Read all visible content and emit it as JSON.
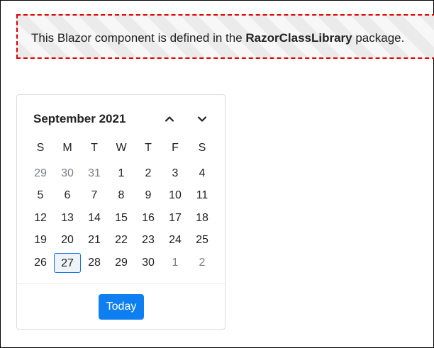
{
  "banner": {
    "prefix": "This Blazor component is defined in the ",
    "package_name": "RazorClassLibrary",
    "suffix": " package."
  },
  "calendar": {
    "month_label": "September 2021",
    "prev_icon": "chevron-up-icon",
    "next_icon": "chevron-down-icon",
    "weekdays": [
      "S",
      "M",
      "T",
      "W",
      "T",
      "F",
      "S"
    ],
    "weeks": [
      [
        {
          "d": "29",
          "other": true
        },
        {
          "d": "30",
          "other": true
        },
        {
          "d": "31",
          "other": true
        },
        {
          "d": "1"
        },
        {
          "d": "2"
        },
        {
          "d": "3"
        },
        {
          "d": "4"
        }
      ],
      [
        {
          "d": "5"
        },
        {
          "d": "6"
        },
        {
          "d": "7"
        },
        {
          "d": "8"
        },
        {
          "d": "9"
        },
        {
          "d": "10"
        },
        {
          "d": "11"
        }
      ],
      [
        {
          "d": "12"
        },
        {
          "d": "13"
        },
        {
          "d": "14"
        },
        {
          "d": "15"
        },
        {
          "d": "16"
        },
        {
          "d": "17"
        },
        {
          "d": "18"
        }
      ],
      [
        {
          "d": "19"
        },
        {
          "d": "20"
        },
        {
          "d": "21"
        },
        {
          "d": "22"
        },
        {
          "d": "23"
        },
        {
          "d": "24"
        },
        {
          "d": "25"
        }
      ],
      [
        {
          "d": "26"
        },
        {
          "d": "27",
          "selected": true
        },
        {
          "d": "28"
        },
        {
          "d": "29"
        },
        {
          "d": "30"
        },
        {
          "d": "1",
          "other": true
        },
        {
          "d": "2",
          "other": true
        }
      ]
    ],
    "today_label": "Today"
  },
  "colors": {
    "banner_border": "#e00000",
    "accent": "#0d7ff0",
    "selected_border": "#1a73e8"
  }
}
